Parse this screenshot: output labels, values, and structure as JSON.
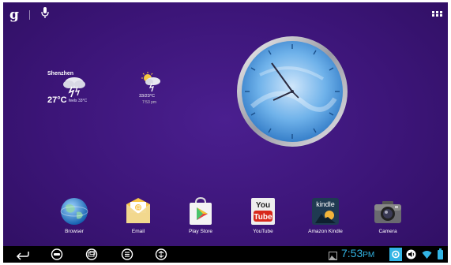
{
  "search": {
    "google_glyph": "g",
    "icons": [
      "google-search-icon",
      "voice-search-icon"
    ]
  },
  "weather_widgets": [
    {
      "city": "Shenzhen",
      "temperature": "27°C",
      "feels_like": "feels 33°C"
    },
    {
      "range": "33/23°C",
      "updated": "7:53 pm"
    }
  ],
  "dock_apps": [
    {
      "label": "Browser",
      "icon": "globe-icon"
    },
    {
      "label": "Email",
      "icon": "email-icon"
    },
    {
      "label": "Play Store",
      "icon": "play-store-icon"
    },
    {
      "label": "YouTube",
      "icon": "youtube-icon",
      "logo_text_top": "You",
      "logo_text_bottom": "Tube"
    },
    {
      "label": "Amazon Kindle",
      "icon": "kindle-icon",
      "logo_text": "kindle"
    },
    {
      "label": "Camera",
      "icon": "camera-icon"
    }
  ],
  "status_bar": {
    "time_hour_min": "7:53",
    "time_suffix": "PM"
  },
  "colors": {
    "wallpaper": "#3c1578",
    "navbar": "#000000",
    "clock_accent": "#33b5e5"
  }
}
